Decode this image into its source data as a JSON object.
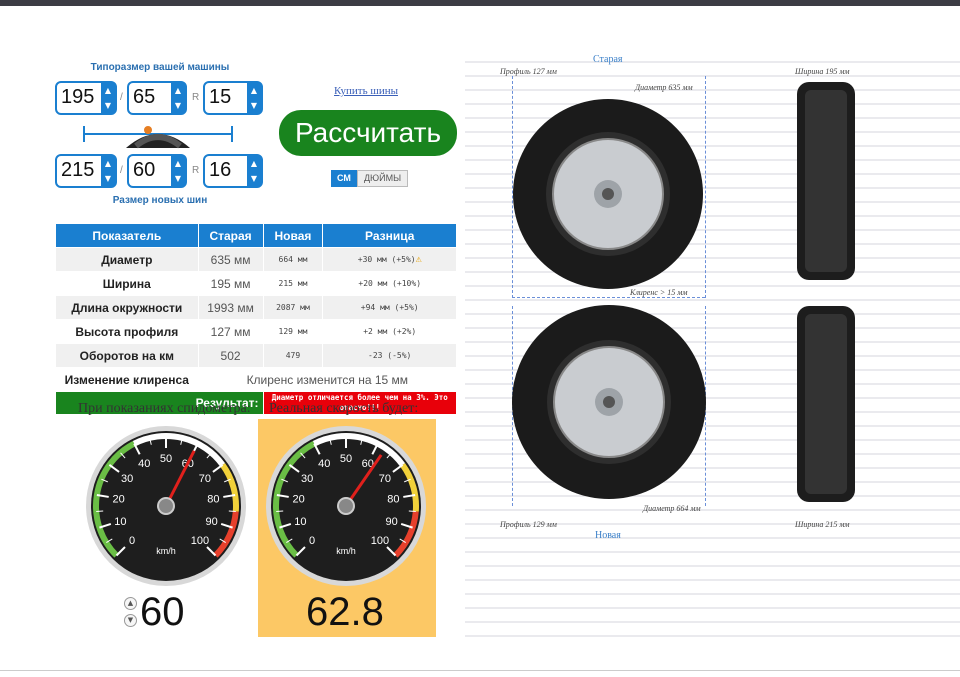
{
  "calculator": {
    "top_label": "Типоразмер вашей машины",
    "bottom_label": "Размер новых шин",
    "old": {
      "width": "195",
      "profile": "65",
      "radius": "15"
    },
    "new": {
      "width": "215",
      "profile": "60",
      "radius": "16"
    },
    "sep_slash": "/",
    "sep_r": "R",
    "buy_link": "Купить шины",
    "calc_button": "Рассчитать",
    "unit_cm": "СМ",
    "unit_in": "ДЮЙМЫ"
  },
  "table": {
    "headers": [
      "Показатель",
      "Старая",
      "Новая",
      "Разница"
    ],
    "rows": [
      {
        "k": "Диаметр",
        "o": "635 мм",
        "n": "664 мм",
        "d": "+30 мм (+5%)"
      },
      {
        "k": "Ширина",
        "o": "195 мм",
        "n": "215 мм",
        "d": "+20 мм (+10%)"
      },
      {
        "k": "Длина окружности",
        "o": "1993 мм",
        "n": "2087 мм",
        "d": "+94 мм (+5%)"
      },
      {
        "k": "Высота профиля",
        "o": "127 мм",
        "n": "129 мм",
        "d": "+2 мм (+2%)"
      },
      {
        "k": "Оборотов на км",
        "o": "502",
        "n": "479",
        "d": "-23 (-5%)"
      }
    ],
    "clearance_label": "Изменение клиренса",
    "clearance_value": "Клиренс изменится на 15 мм",
    "result_label": "Результат:",
    "result_value": "Диаметр отличается более чем на 3%. Это опасно!!!"
  },
  "speed": {
    "caption_left": "При показаниях спидометра:",
    "caption_right": "Реальная скорость будет:",
    "unit": "km/h",
    "ticks": [
      "0",
      "10",
      "20",
      "30",
      "40",
      "50",
      "60",
      "70",
      "80",
      "90",
      "100"
    ],
    "input_value": "60",
    "input_needle": 60,
    "real_value": "62.8",
    "real_needle": 62.8,
    "spin_up": "▲",
    "spin_down": "▼"
  },
  "diagram": {
    "old_title": "Старая",
    "new_title": "Новая",
    "old_profile": "Профиль 127 мм",
    "old_width": "Ширина 195 мм",
    "old_diameter": "Диаметр 635 мм",
    "clearance": "Клиренс > 15 мм",
    "new_profile": "Профиль 129 мм",
    "new_width": "Ширина 215 мм",
    "new_diameter": "Диаметр 664 мм"
  },
  "colors": {
    "accent": "#1a7fd0",
    "green": "#19841e",
    "red": "#e8000a",
    "orange": "#fcc865"
  }
}
